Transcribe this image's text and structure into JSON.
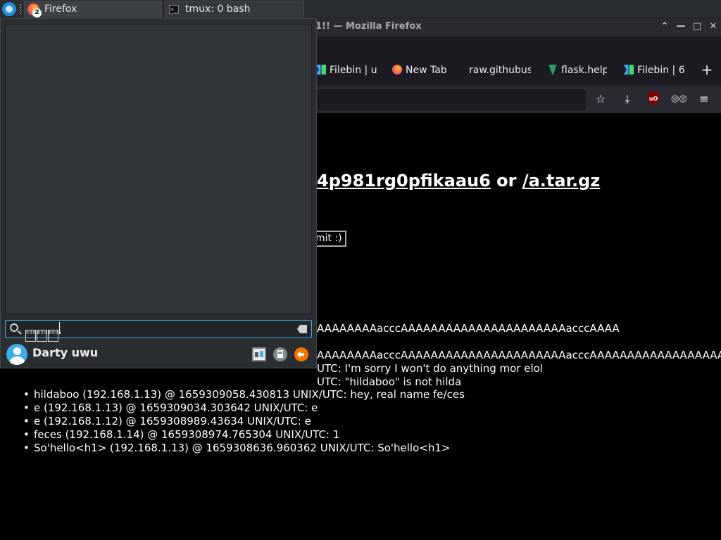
{
  "taskbar": {
    "tasks": [
      {
        "label": "Firefox",
        "badge": "2",
        "icon": "firefox-icon"
      },
      {
        "label": "tmux: 0 bash",
        "icon": "terminal-icon"
      }
    ]
  },
  "firefox": {
    "window_title": "1!! — Mozilla Firefox",
    "tabs": [
      {
        "label": "Filebin | u",
        "icon": "filebin-icon"
      },
      {
        "label": "New Tab",
        "icon": "firefox-icon"
      },
      {
        "label": "raw.githubus",
        "icon": ""
      },
      {
        "label": "flask.help",
        "icon": "flask-icon"
      },
      {
        "label": "Filebin | 6",
        "icon": "filebin-icon"
      }
    ],
    "new_tab": "+",
    "nav_icons": [
      "bookmark-star-icon",
      "download-icon",
      "ublock-icon",
      "privacy-glasses-icon",
      "menu-icon"
    ],
    "ublock_label": "uO",
    "window_controls": {
      "minimize": "—",
      "maximize": "□",
      "close": "✕",
      "up": "⌃"
    }
  },
  "page": {
    "heading_link1": "4p981rg0pfikaau6",
    "heading_or": " or ",
    "heading_link2": "/a.tar.gz",
    "submit": "mit :)",
    "aline1": "AAAAAAAAacccAAAAAAAAAAAAAAAAAAAAAAacccAAAA",
    "aline2": "AAAAAAAAacccAAAAAAAAAAAAAAAAAAAAAAacccAAAAAAAAAAAAAAAAAAAAAA",
    "tail1": "UTC: I'm sorry I won't do anything mor elol",
    "tail2": "UTC: \"hildaboo\" is not hilda",
    "messages": [
      "hildaboo (192.168.1.13) @ 1659309058.430813 UNIX/UTC: hey, real name fe/ces",
      "e (192.168.1.13) @ 1659309034.303642 UNIX/UTC: e",
      "e (192.168.1.12) @ 1659308989.43634 UNIX/UTC: e",
      "feces (192.168.1.14) @ 1659308974.765304 UNIX/UTC: 1",
      "So'hello<h1> (192.168.1.13) @ 1659308636.960362 UNIX/UTC: So'hello<h1>"
    ]
  },
  "launcher": {
    "search_glyphs": [
      "0000",
      "0000",
      "0001"
    ],
    "user_name": "Darty uwu",
    "buttons": [
      "switch-user-icon",
      "lock-icon",
      "logout-icon"
    ],
    "colors": {
      "accent": "#3daee9",
      "logout": "#f67400"
    }
  }
}
